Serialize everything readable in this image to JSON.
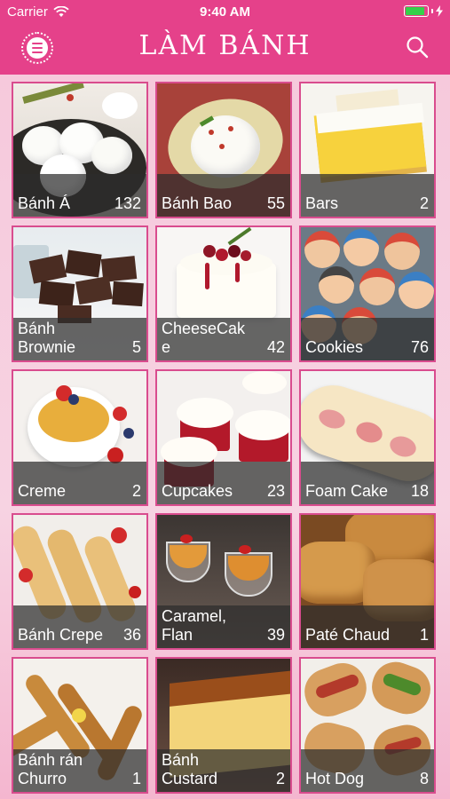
{
  "status_bar": {
    "carrier": "Carrier",
    "time": "9:40 AM",
    "battery_level": 0.8
  },
  "nav": {
    "logo": "LÀM BÁNH",
    "menu_icon": "menu-icon",
    "search_icon": "search-icon"
  },
  "colors": {
    "brand": "#e5418a",
    "caption_bg": "#2d2d2d",
    "battery": "#35d04a"
  },
  "categories": [
    {
      "name": "Bánh Á",
      "count": "132"
    },
    {
      "name": "Bánh Bao",
      "count": "55"
    },
    {
      "name": "Bars",
      "count": "2"
    },
    {
      "name": "Bánh\nBrownie",
      "count": "5"
    },
    {
      "name": "CheeseCak\ne",
      "count": "42"
    },
    {
      "name": "Cookies",
      "count": "76"
    },
    {
      "name": "Creme",
      "count": "2"
    },
    {
      "name": "Cupcakes",
      "count": "23"
    },
    {
      "name": "Foam Cake",
      "count": "18"
    },
    {
      "name": "Bánh Crepe",
      "count": "36"
    },
    {
      "name": "Caramel,\nFlan",
      "count": "39"
    },
    {
      "name": "Paté Chaud",
      "count": "1"
    },
    {
      "name": "Bánh rán\nChurro",
      "count": "1"
    },
    {
      "name": "Bánh\nCustard",
      "count": "2"
    },
    {
      "name": "Hot Dog",
      "count": "8"
    }
  ]
}
